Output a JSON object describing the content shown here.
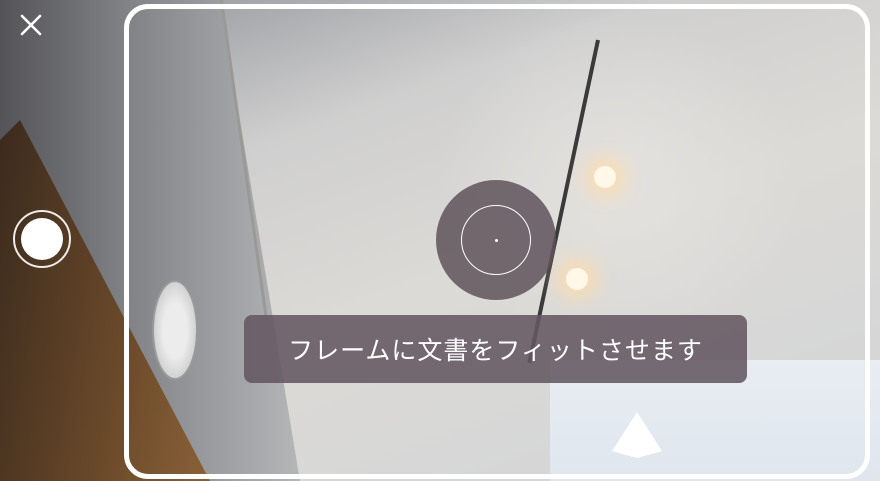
{
  "camera": {
    "hint_text": "フレームに文書をフィットさせます"
  },
  "icons": {
    "close": "close-icon",
    "shutter": "shutter-icon",
    "focus": "focus-reticle-icon"
  },
  "colors": {
    "frame": "#ffffff",
    "hint_bg": "#645862",
    "focus_bg": "#5f525a"
  }
}
